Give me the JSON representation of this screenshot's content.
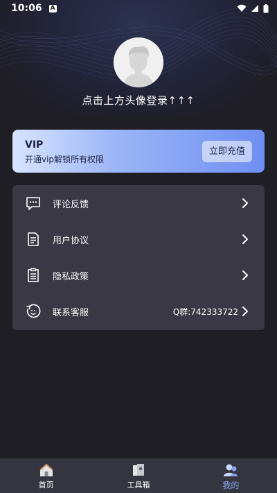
{
  "status_bar": {
    "time": "10:06",
    "notification_icon": "A"
  },
  "profile": {
    "login_hint": "点击上方头像登录↑↑↑"
  },
  "vip": {
    "title": "VIP",
    "subtitle": "开通vip解锁所有权限",
    "button": "立即充值"
  },
  "menu": [
    {
      "label": "评论反馈",
      "extra": "",
      "icon": "comment-icon"
    },
    {
      "label": "用户协议",
      "extra": "",
      "icon": "document-icon"
    },
    {
      "label": "隐私政策",
      "extra": "",
      "icon": "clipboard-icon"
    },
    {
      "label": "联系客服",
      "extra": "Q群:742333722",
      "icon": "service-icon"
    }
  ],
  "tabs": [
    {
      "label": "首页",
      "icon": "home-icon"
    },
    {
      "label": "工具箱",
      "icon": "toolbox-icon"
    },
    {
      "label": "我的",
      "icon": "profile-icon",
      "active": true
    }
  ],
  "colors": {
    "accent": "#8aa2f5",
    "background": "#1f1e25",
    "card": "#393844",
    "tab_bar": "#35353f"
  }
}
